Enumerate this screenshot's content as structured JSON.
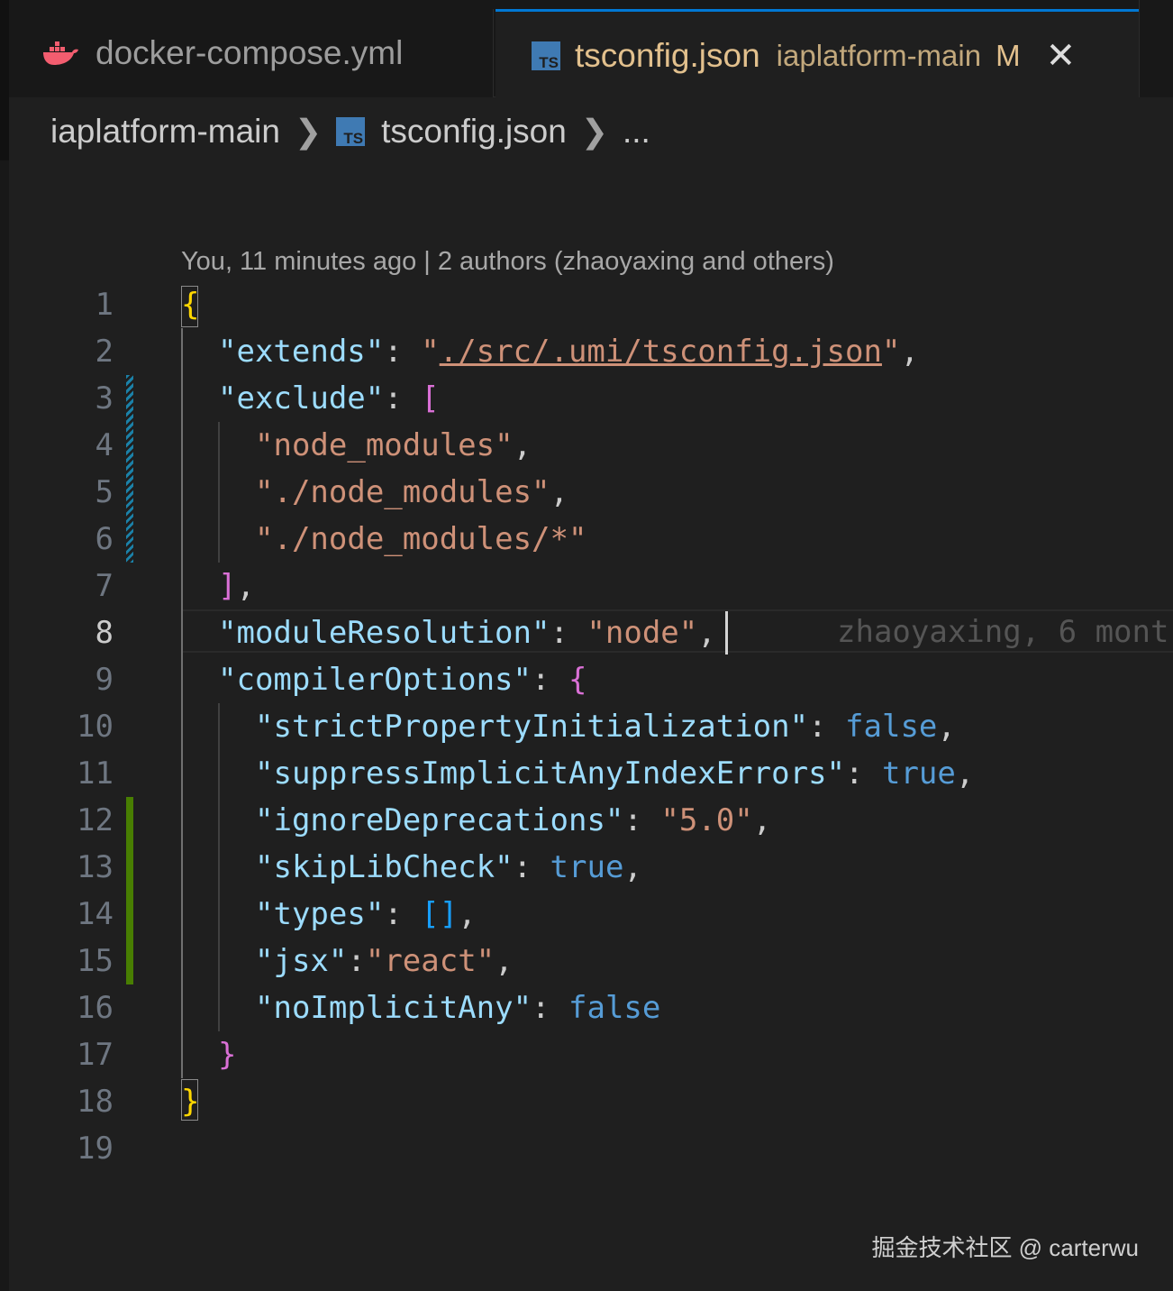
{
  "tabs": [
    {
      "label": "docker-compose.yml",
      "icon": "docker-icon",
      "active": false
    },
    {
      "label": "tsconfig.json",
      "icon": "ts-icon",
      "description": "iaplatform-main",
      "status": "M",
      "close": "✕",
      "active": true
    }
  ],
  "breadcrumb": {
    "folder": "iaplatform-main",
    "file": "tsconfig.json",
    "more": "..."
  },
  "codelens": "You, 11 minutes ago | 2 authors (zhaoyaxing and others)",
  "editor": {
    "active_line": 8,
    "blame": "zhaoyaxing, 6 mont",
    "line_numbers": [
      "1",
      "2",
      "3",
      "4",
      "5",
      "6",
      "7",
      "8",
      "9",
      "10",
      "11",
      "12",
      "13",
      "14",
      "15",
      "16",
      "17",
      "18",
      "19"
    ],
    "lines": {
      "l1": {
        "open": "{"
      },
      "l2": {
        "key": "\"extends\"",
        "colon": ": ",
        "q1": "\"",
        "val": "./src/.umi/tsconfig.json",
        "q2": "\"",
        "comma": ","
      },
      "l3": {
        "key": "\"exclude\"",
        "colon": ": ",
        "open": "["
      },
      "l4": {
        "val": "\"node_modules\"",
        "comma": ","
      },
      "l5": {
        "val": "\"./node_modules\"",
        "comma": ","
      },
      "l6": {
        "val": "\"./node_modules/*\""
      },
      "l7": {
        "close": "]",
        "comma": ","
      },
      "l8": {
        "key": "\"moduleResolution\"",
        "colon": ": ",
        "val": "\"node\"",
        "comma": ","
      },
      "l9": {
        "key": "\"compilerOptions\"",
        "colon": ": ",
        "open": "{"
      },
      "l10": {
        "key": "\"strictPropertyInitialization\"",
        "colon": ": ",
        "val": "false",
        "comma": ","
      },
      "l11": {
        "key": "\"suppressImplicitAnyIndexErrors\"",
        "colon": ": ",
        "val": "true",
        "comma": ","
      },
      "l12": {
        "key": "\"ignoreDeprecations\"",
        "colon": ": ",
        "val": "\"5.0\"",
        "comma": ","
      },
      "l13": {
        "key": "\"skipLibCheck\"",
        "colon": ": ",
        "val": "true",
        "comma": ","
      },
      "l14": {
        "key": "\"types\"",
        "colon": ": ",
        "val": "[]",
        "comma": ","
      },
      "l15": {
        "key": "\"jsx\"",
        "colon": ":",
        "val": "\"react\"",
        "comma": ","
      },
      "l16": {
        "key": "\"noImplicitAny\"",
        "colon": ": ",
        "val": "false"
      },
      "l17": {
        "close": "}"
      },
      "l18": {
        "close": "}"
      }
    }
  },
  "watermark": "掘金技术社区 @ carterwu",
  "colors": {
    "background": "#1f1f1f",
    "tab_active_border": "#0078d4",
    "modified_tab_text": "#e2c08d",
    "json_key": "#9cdcfe",
    "json_string": "#ce9178",
    "json_keyword": "#569cd6",
    "gutter_modified": "#1b81a8",
    "gutter_added": "#487e02"
  }
}
